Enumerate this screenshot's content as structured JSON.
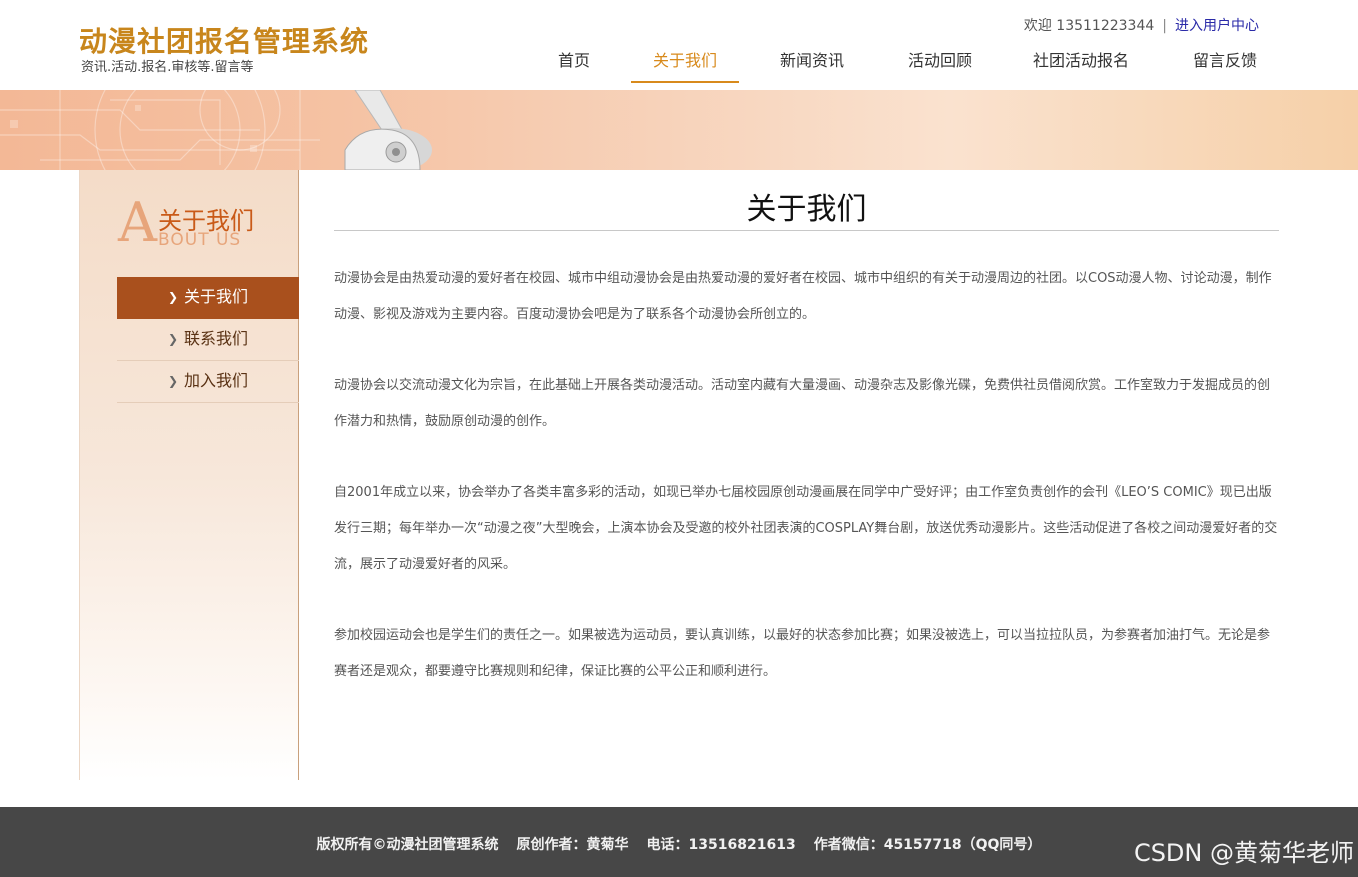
{
  "header": {
    "site_title": "动漫社团报名管理系统",
    "site_subtitle": "资讯.活动.报名.审核等.留言等",
    "welcome": "欢迎 13511223344",
    "separator": "|",
    "user_center": "进入用户中心"
  },
  "nav": {
    "items": [
      {
        "label": "首页"
      },
      {
        "label": "关于我们",
        "active": true
      },
      {
        "label": "新闻资讯"
      },
      {
        "label": "活动回顾"
      },
      {
        "label": "社团活动报名"
      },
      {
        "label": "留言反馈"
      }
    ]
  },
  "sidebar": {
    "heading_initial": "A",
    "heading_zh": "关于我们",
    "heading_en": "BOUT US",
    "items": [
      {
        "label": "关于我们",
        "active": true
      },
      {
        "label": "联系我们"
      },
      {
        "label": "加入我们"
      }
    ]
  },
  "main": {
    "title": "关于我们",
    "paragraphs": [
      "动漫协会是由热爱动漫的爱好者在校园、城市中组动漫协会是由热爱动漫的爱好者在校园、城市中组织的有关于动漫周边的社团。以COS动漫人物、讨论动漫，制作动漫、影视及游戏为主要内容。百度动漫协会吧是为了联系各个动漫协会所创立的。",
      "动漫协会以交流动漫文化为宗旨，在此基础上开展各类动漫活动。活动室内藏有大量漫画、动漫杂志及影像光碟，免费供社员借阅欣赏。工作室致力于发掘成员的创作潜力和热情，鼓励原创动漫的创作。",
      "自2001年成立以来，协会举办了各类丰富多彩的活动，如现已举办七届校园原创动漫画展在同学中广受好评；由工作室负责创作的会刊《LEO’S COMIC》现已出版发行三期；每年举办一次“动漫之夜”大型晚会，上演本协会及受邀的校外社团表演的COSPLAY舞台剧，放送优秀动漫影片。这些活动促进了各校之间动漫爱好者的交流，展示了动漫爱好者的风采。",
      "参加校园运动会也是学生们的责任之一。如果被选为运动员，要认真训练，以最好的状态参加比赛；如果没被选上，可以当拉拉队员，为参赛者加油打气。无论是参赛者还是观众，都要遵守比赛规则和纪律，保证比赛的公平公正和顺利进行。"
    ]
  },
  "footer": {
    "copyright": "版权所有©动漫社团管理系统",
    "author": "原创作者：黄菊华",
    "phone": "电话：13516821613",
    "wechat": "作者微信：45157718（QQ同号）",
    "watermark": "CSDN @黄菊华老师"
  }
}
